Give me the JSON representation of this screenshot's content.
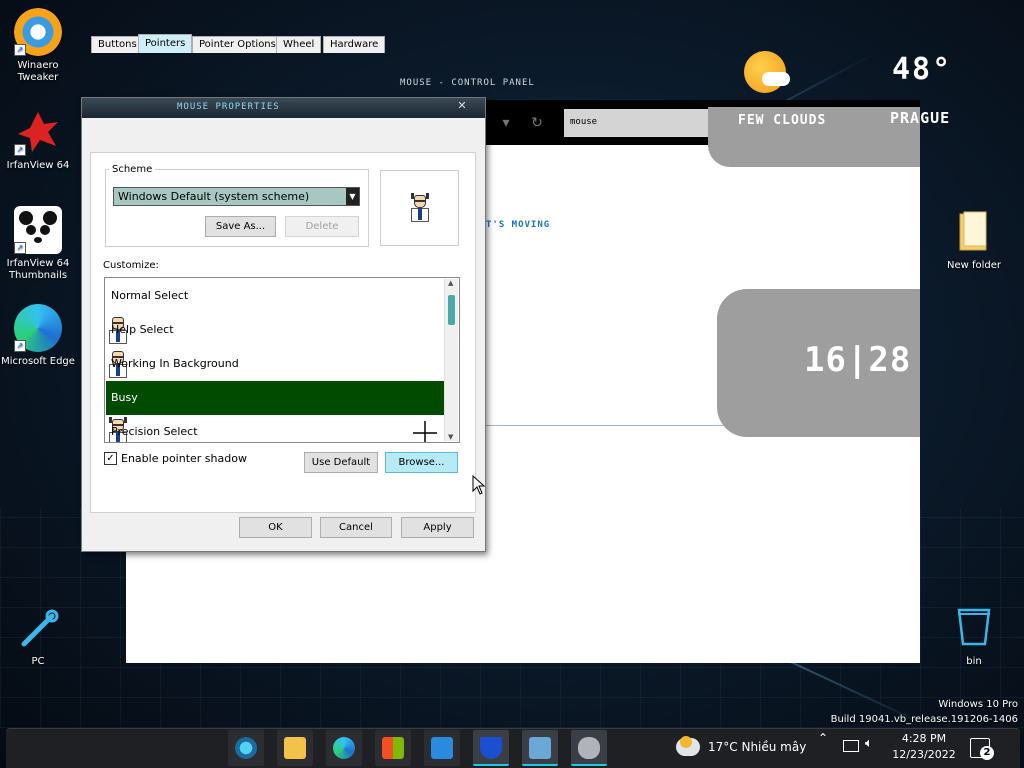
{
  "desktop": {
    "icons": [
      {
        "label": "Winaero\nTweaker"
      },
      {
        "label": "IrfanView 64"
      },
      {
        "label": "IrfanView 64\nThumbnails"
      },
      {
        "label": "Microsoft Edge"
      },
      {
        "label": "PC"
      },
      {
        "label": "New folder"
      },
      {
        "label": "bin"
      }
    ],
    "watermark": {
      "line1": "Windows 10 Pro",
      "line2": "Build 19041.vb_release.191206-1406"
    }
  },
  "control_panel": {
    "title": "MOUSE - CONTROL PANEL",
    "search_value": "mouse",
    "moving_text": "T'S MOVING"
  },
  "weather_widget": {
    "temperature": "48°",
    "description": "FEW CLOUDS",
    "city": "PRAGUE"
  },
  "clock_widget": {
    "time": "16|28"
  },
  "dialog": {
    "title": "MOUSE PROPERTIES",
    "tabs": [
      {
        "label": "Buttons",
        "active": false
      },
      {
        "label": "Pointers",
        "active": true
      },
      {
        "label": "Pointer Options",
        "active": false
      },
      {
        "label": "Wheel",
        "active": false
      },
      {
        "label": "Hardware",
        "active": false
      }
    ],
    "scheme": {
      "group_label": "Scheme",
      "selected": "Windows Default (system scheme)",
      "save_as": "Save As...",
      "delete": "Delete"
    },
    "customize_label": "Customize:",
    "cursor_list": [
      {
        "label": "Normal Select",
        "selected": false,
        "icon": "glasses-figure"
      },
      {
        "label": "Help Select",
        "selected": false,
        "icon": "glasses-figure"
      },
      {
        "label": "Working In Background",
        "selected": false,
        "icon": "eared-figure"
      },
      {
        "label": "Busy",
        "selected": true,
        "icon": "eared-figure"
      },
      {
        "label": "Precision Select",
        "selected": false,
        "icon": "crosshair-icon"
      }
    ],
    "enable_shadow": {
      "label": "Enable pointer shadow",
      "checked": true
    },
    "use_default": "Use Default",
    "browse": "Browse...",
    "ok": "OK",
    "cancel": "Cancel",
    "apply": "Apply"
  },
  "taskbar": {
    "weather_text": "17°C  Nhiều mây",
    "time": "4:28 PM",
    "date": "12/23/2022",
    "notification_count": "2",
    "apps": [
      "media-player-icon",
      "file-explorer-icon",
      "edge-icon",
      "store-icon",
      "mail-icon",
      "security-icon",
      "control-panel-icon",
      "mouse-icon"
    ]
  },
  "colors": {
    "accent": "#19c9e6",
    "selected_row": "#004b00",
    "combo_bg": "#a7c7c1",
    "widget_gray": "#9e9e9e"
  }
}
